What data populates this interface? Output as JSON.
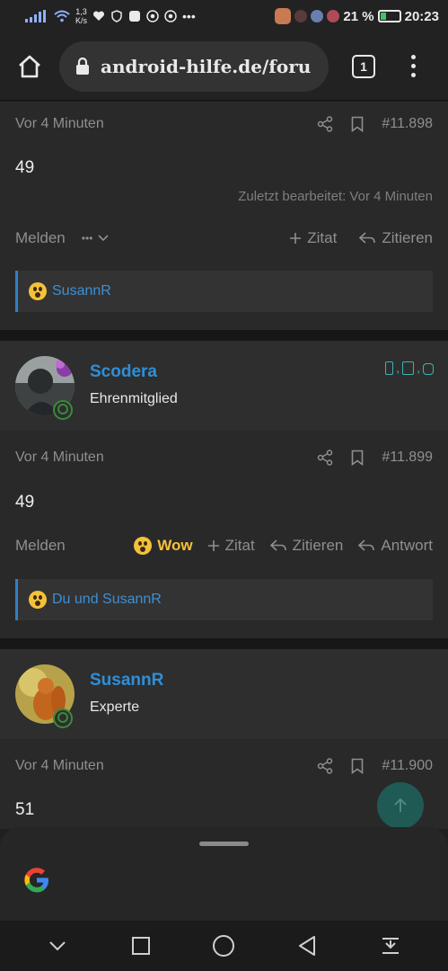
{
  "status_bar": {
    "speed_value": "1,3",
    "speed_unit": "K/s",
    "battery_percent": "21 %",
    "time": "20:23"
  },
  "browser": {
    "url": "android-hilfe.de/foru",
    "tab_count": "1"
  },
  "posts": [
    {
      "time": "Vor 4 Minuten",
      "post_number": "#11.898",
      "content": "49",
      "edit_note": "Zuletzt bearbeitet: Vor 4 Minuten",
      "actions": {
        "report": "Melden",
        "more": "•••",
        "quote_plus": "Zitat",
        "reply_quote": "Zitieren"
      },
      "reaction_users": "SusannR"
    },
    {
      "username": "Scodera",
      "user_title": "Ehrenmitglied",
      "time": "Vor 4 Minuten",
      "post_number": "#11.899",
      "content": "49",
      "actions": {
        "report": "Melden",
        "reaction": "Wow",
        "quote_plus": "Zitat",
        "reply_quote": "Zitieren",
        "reply": "Antwort"
      },
      "reaction_users": "Du und SusannR"
    },
    {
      "username": "SusannR",
      "user_title": "Experte",
      "time": "Vor 4 Minuten",
      "post_number": "#11.900",
      "content": "51"
    }
  ],
  "colors": {
    "accent": "#2e8fd9",
    "reaction_bar_border": "#2f7fc4",
    "wow": "#f5c13a",
    "device_icons": "#3ab4b4"
  }
}
